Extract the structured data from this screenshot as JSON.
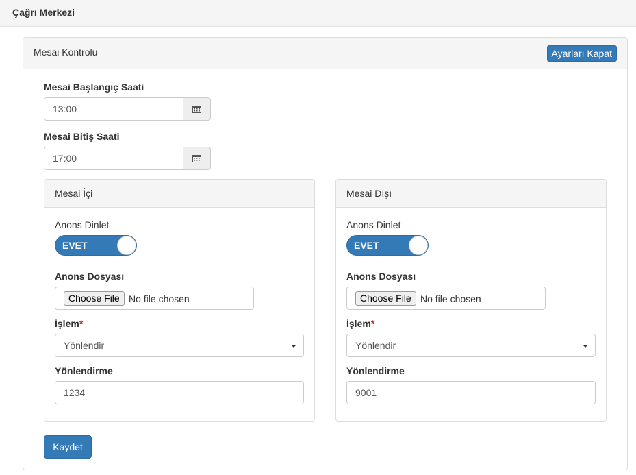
{
  "header": {
    "title": "Çağrı Merkezi"
  },
  "panel": {
    "title": "Mesai Kontrolu",
    "close_button": "Ayarları Kapat",
    "start": {
      "label": "Mesai Başlangıç Saati",
      "value": "13:00",
      "icon": "calendar-icon"
    },
    "end": {
      "label": "Mesai Bitiş Saati",
      "value": "17:00",
      "icon": "calendar-icon"
    },
    "inside": {
      "title": "Mesai İçi",
      "announce_label": "Anons Dinlet",
      "toggle_text": "EVET",
      "file_label": "Anons Dosyası",
      "choose_file": "Choose File",
      "no_file": "No file chosen",
      "action_label": "İşlem",
      "required_mark": "*",
      "action_value": "Yönlendir",
      "redirect_label": "Yönlendirme",
      "redirect_value": "1234"
    },
    "outside": {
      "title": "Mesai Dışı",
      "announce_label": "Anons Dinlet",
      "toggle_text": "EVET",
      "file_label": "Anons Dosyası",
      "choose_file": "Choose File",
      "no_file": "No file chosen",
      "action_label": "İşlem",
      "required_mark": "*",
      "action_value": "Yönlendir",
      "redirect_label": "Yönlendirme",
      "redirect_value": "9001"
    },
    "save_button": "Kaydet"
  },
  "colors": {
    "primary": "#337ab7",
    "required": "#c9302c"
  }
}
